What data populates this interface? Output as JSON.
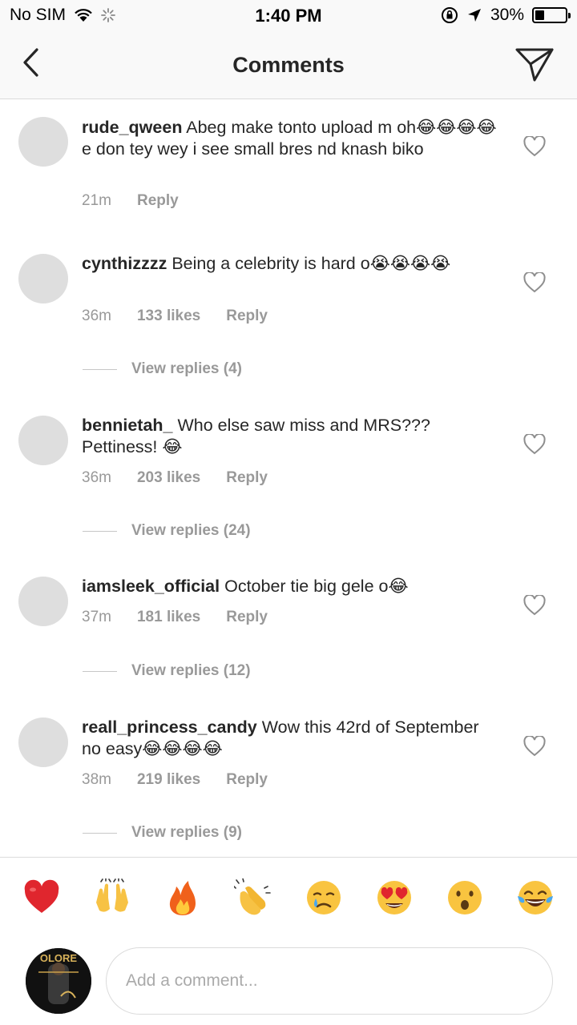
{
  "status_bar": {
    "carrier": "No SIM",
    "time": "1:40 PM",
    "battery_percent": "30%",
    "battery_level": 0.3
  },
  "header": {
    "title": "Comments",
    "back_icon": "chevron-left-icon",
    "send_icon": "paper-plane-icon"
  },
  "comments": [
    {
      "username": "rude_qween",
      "text": "Abeg make tonto upload m oh😂😂😂😂e don tey wey i see small bres nd knash biko",
      "time": "21m",
      "likes": "",
      "reply_label": "Reply",
      "view_replies": ""
    },
    {
      "username": "cynthizzzz",
      "text": "Being a celebrity is hard o😭😭😭😭",
      "time": "36m",
      "likes": "133 likes",
      "reply_label": "Reply",
      "view_replies": "View replies (4)"
    },
    {
      "username": "bennietah_",
      "text": "Who else saw miss and MRS??? Pettiness! 😂",
      "time": "36m",
      "likes": "203 likes",
      "reply_label": "Reply",
      "view_replies": "View replies (24)"
    },
    {
      "username": "iamsleek_official",
      "text": "October tie big gele o😂",
      "time": "37m",
      "likes": "181 likes",
      "reply_label": "Reply",
      "view_replies": "View replies (12)"
    },
    {
      "username": "reall_princess_candy",
      "text": "Wow this 42rd of September no easy😂😂😂😂",
      "time": "38m",
      "likes": "219 likes",
      "reply_label": "Reply",
      "view_replies": "View replies (9)"
    }
  ],
  "emoji_bar": [
    "❤️",
    "🙌",
    "🔥",
    "👏",
    "😢",
    "😍",
    "😮",
    "😂"
  ],
  "input": {
    "placeholder": "Add a comment...",
    "avatar_text": "OLORE"
  }
}
